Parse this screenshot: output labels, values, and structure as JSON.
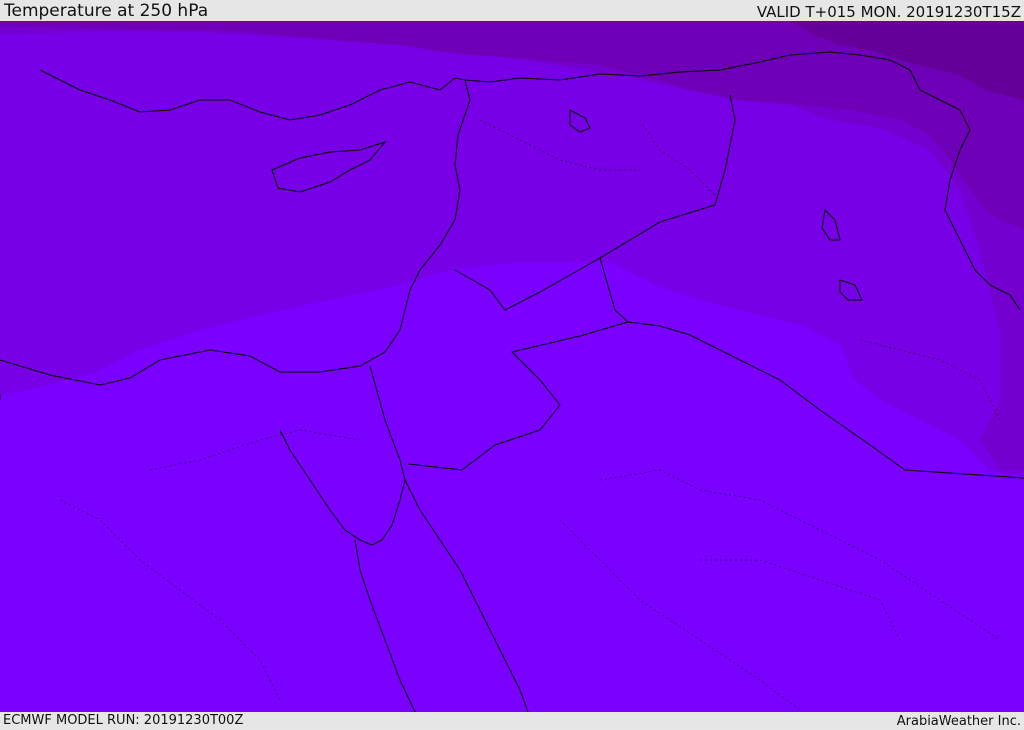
{
  "header": {
    "title": "Temperature at 250 hPa",
    "valid": "VALID T+015 MON. 20191230T15Z"
  },
  "footer": {
    "model_run": "ECMWF MODEL RUN: 20191230T00Z",
    "credit": "ArabiaWeather Inc."
  },
  "map": {
    "colors": {
      "band_1": "#7a00ff",
      "band_2": "#7700e6",
      "band_3": "#7400cf",
      "band_4": "#6e00b8",
      "band_5": "#640099",
      "coast": "#000000"
    }
  }
}
